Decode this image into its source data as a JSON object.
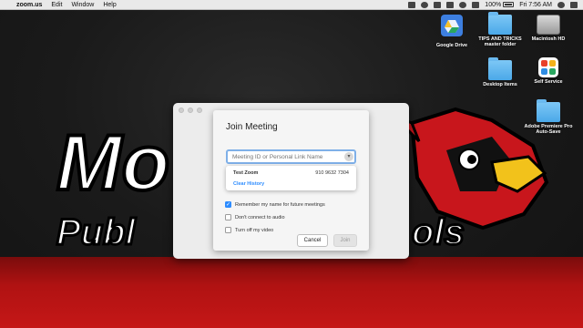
{
  "menubar": {
    "apple": "",
    "app_name": "zoom.us",
    "menus": [
      "Edit",
      "Window",
      "Help"
    ],
    "battery": "100%",
    "time": "Fri 7:56 AM"
  },
  "background": {
    "text_line1": "Mo",
    "text_line2": "Publ",
    "text_line3": "ols"
  },
  "desktop": {
    "icons": [
      {
        "label": "Google Drive",
        "icon": "google-drive-icon"
      },
      {
        "label": "TIPS AND TRICKS master folder",
        "icon": "folder-icon"
      },
      {
        "label": "Macintosh HD",
        "icon": "hard-drive-icon"
      },
      {
        "label": "Desktop Items",
        "icon": "folder-icon"
      },
      {
        "label": "Self Service",
        "icon": "self-service-icon"
      },
      {
        "label": "Adobe Premiere Pro Auto-Save",
        "icon": "folder-icon"
      }
    ]
  },
  "dialog": {
    "title": "Join Meeting",
    "input_placeholder": "Meeting ID or Personal Link Name",
    "history": [
      {
        "name": "Test Zoom",
        "id": "910 9632 7304"
      }
    ],
    "clear_history": "Clear History",
    "options": [
      {
        "label": "Remember my name for future meetings",
        "checked": true
      },
      {
        "label": "Don't connect to audio",
        "checked": false
      },
      {
        "label": "Turn off my video",
        "checked": false
      }
    ],
    "cancel_label": "Cancel",
    "join_label": "Join"
  },
  "colors": {
    "accent": "#2d8cff",
    "input_focus": "#7fb0e8",
    "cardinal_red": "#c8161c"
  }
}
